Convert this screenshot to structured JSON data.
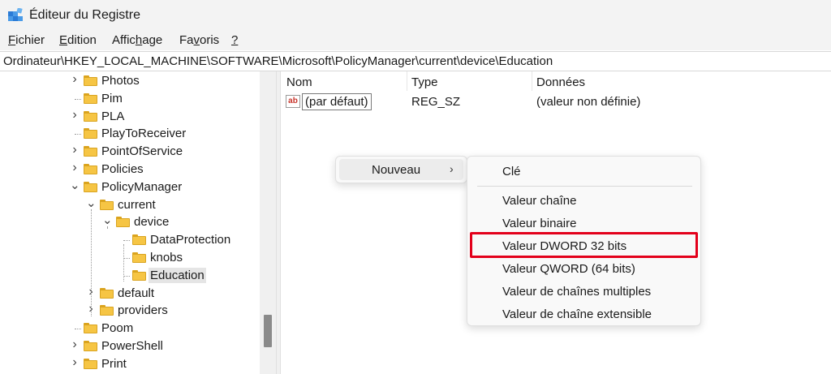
{
  "window": {
    "title": "Éditeur du Registre",
    "icon": "regedit-icon"
  },
  "menubar": [
    {
      "pre": "",
      "u": "F",
      "post": "ichier"
    },
    {
      "pre": "",
      "u": "E",
      "post": "dition"
    },
    {
      "pre": "Affic",
      "u": "h",
      "post": "age"
    },
    {
      "pre": "Fa",
      "u": "v",
      "post": "oris"
    },
    {
      "pre": "",
      "u": "?",
      "post": ""
    }
  ],
  "address": "Ordinateur\\HKEY_LOCAL_MACHINE\\SOFTWARE\\Microsoft\\PolicyManager\\current\\device\\Education",
  "tree": [
    {
      "label": "Photos",
      "level": 0,
      "expander": "collapsed"
    },
    {
      "label": "Pim",
      "level": 0,
      "expander": "none"
    },
    {
      "label": "PLA",
      "level": 0,
      "expander": "collapsed"
    },
    {
      "label": "PlayToReceiver",
      "level": 0,
      "expander": "none"
    },
    {
      "label": "PointOfService",
      "level": 0,
      "expander": "collapsed"
    },
    {
      "label": "Policies",
      "level": 0,
      "expander": "collapsed"
    },
    {
      "label": "PolicyManager",
      "level": 0,
      "expander": "expanded"
    },
    {
      "label": "current",
      "level": 1,
      "expander": "expanded"
    },
    {
      "label": "device",
      "level": 2,
      "expander": "expanded"
    },
    {
      "label": "DataProtection",
      "level": 3,
      "expander": "none"
    },
    {
      "label": "knobs",
      "level": 3,
      "expander": "none"
    },
    {
      "label": "Education",
      "level": 3,
      "expander": "none",
      "selected": true
    },
    {
      "label": "default",
      "level": 1,
      "expander": "collapsed"
    },
    {
      "label": "providers",
      "level": 1,
      "expander": "collapsed"
    },
    {
      "label": "Poom",
      "level": 0,
      "expander": "none"
    },
    {
      "label": "PowerShell",
      "level": 0,
      "expander": "collapsed"
    },
    {
      "label": "Print",
      "level": 0,
      "expander": "collapsed"
    }
  ],
  "list": {
    "columns": {
      "name": "Nom",
      "type": "Type",
      "data": "Données"
    },
    "rows": [
      {
        "icon": "string-value-icon",
        "icon_text": "ab",
        "name": "(par défaut)",
        "type": "REG_SZ",
        "data": "(valeur non définie)"
      }
    ]
  },
  "context_menu": {
    "item": "Nouveau",
    "arrow": "›"
  },
  "submenu": {
    "items": [
      "Clé",
      "Valeur chaîne",
      "Valeur binaire",
      "Valeur DWORD 32 bits",
      "Valeur QWORD (64 bits)",
      "Valeur de chaînes multiples",
      "Valeur de chaîne extensible"
    ],
    "highlighted": "Valeur DWORD 32 bits",
    "highlight_color": "#e3001b"
  },
  "colors": {
    "folder": "#f6c544",
    "chrome": "#f3f3f3"
  }
}
